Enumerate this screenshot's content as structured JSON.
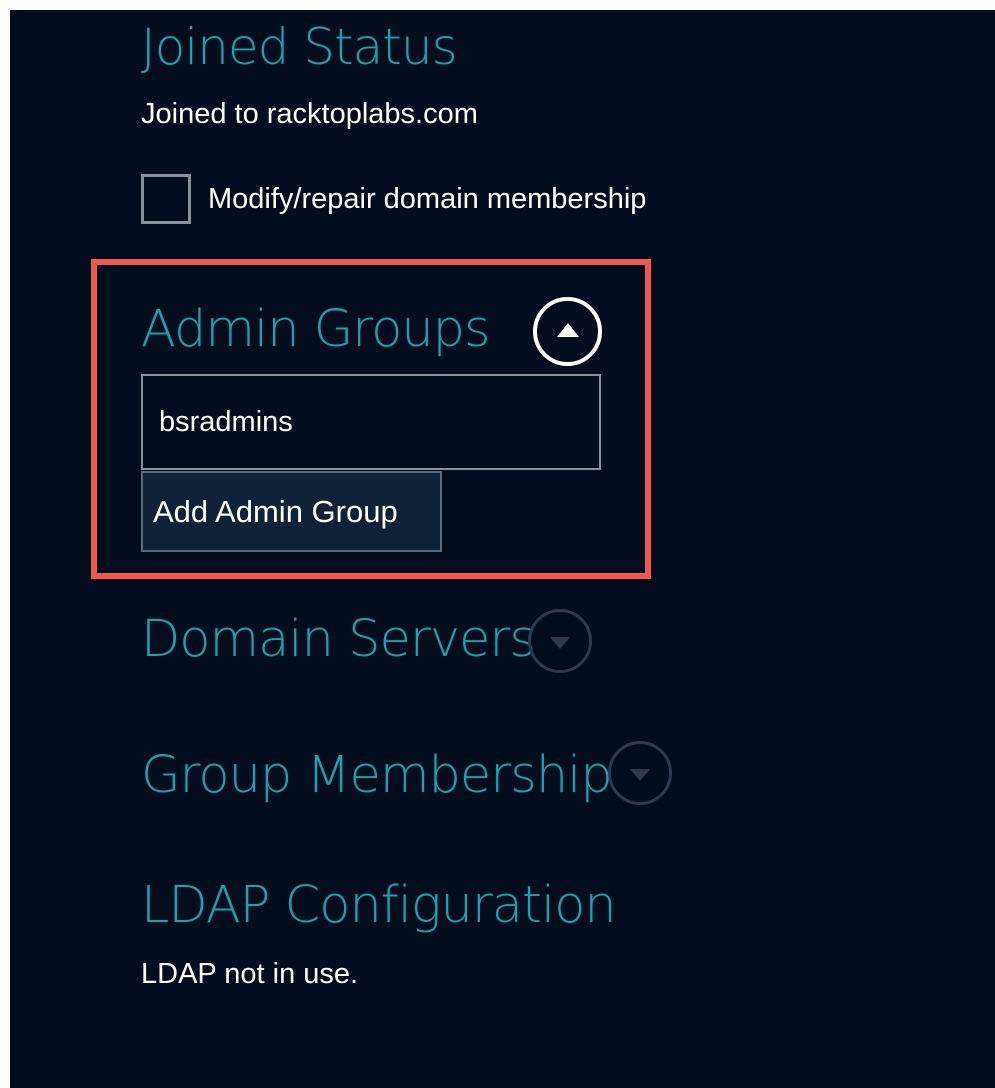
{
  "joined_status": {
    "title": "Joined Status",
    "value": "Joined to racktoplabs.com",
    "modify_checkbox_label": "Modify/repair domain membership",
    "modify_checkbox_checked": false
  },
  "admin_groups": {
    "title": "Admin Groups",
    "expanded": true,
    "toggle_icon": "chevron-up-circle-icon",
    "input_value": "bsradmins",
    "add_button_label": "Add Admin Group",
    "highlight_color": "#f0584f"
  },
  "domain_servers": {
    "title": "Domain Servers",
    "expanded": false,
    "toggle_icon": "chevron-down-circle-icon"
  },
  "group_membership": {
    "title": "Group Membership",
    "expanded": false,
    "toggle_icon": "chevron-down-circle-icon"
  },
  "ldap_configuration": {
    "title": "LDAP Configuration",
    "status_text": "LDAP not in use."
  },
  "colors": {
    "background": "#030d1e",
    "heading": "#17a4ac",
    "text": "#ffffff"
  }
}
